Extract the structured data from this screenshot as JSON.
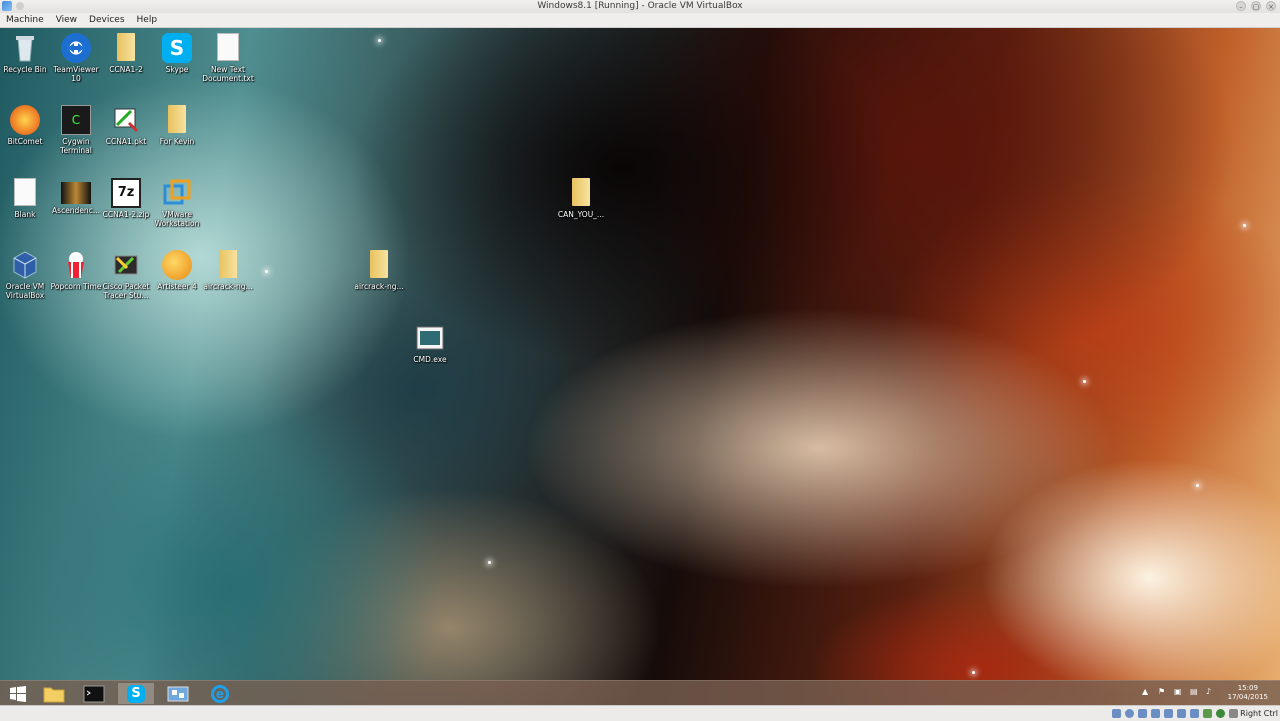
{
  "window": {
    "title": "Windows8.1 [Running] - Oracle VM VirtualBox",
    "controls": [
      "minimize",
      "maximize",
      "close"
    ]
  },
  "menubar": {
    "items": [
      "Machine",
      "View",
      "Devices",
      "Help"
    ]
  },
  "desktop": {
    "icons": [
      {
        "label": "Recycle Bin",
        "icon": "recycle-bin-icon"
      },
      {
        "label": "TeamViewer 10",
        "icon": "teamviewer-icon"
      },
      {
        "label": "CCNA1-2",
        "icon": "folder-icon"
      },
      {
        "label": "Skype",
        "icon": "skype-icon"
      },
      {
        "label": "New Text Document.txt",
        "icon": "text-file-icon"
      },
      {
        "label": "BitComet",
        "icon": "bitcomet-icon"
      },
      {
        "label": "Cygwin Terminal",
        "icon": "cygwin-icon"
      },
      {
        "label": "CCNA1.pkt",
        "icon": "packet-tracer-file-icon"
      },
      {
        "label": "For Kevin",
        "icon": "folder-icon"
      },
      {
        "label": "Blank",
        "icon": "blank-file-icon"
      },
      {
        "label": "Ascendenc...",
        "icon": "image-file-icon"
      },
      {
        "label": "CCNA1-2.zip",
        "icon": "7zip-icon"
      },
      {
        "label": "VMware Workstation",
        "icon": "vmware-icon"
      },
      {
        "label": "Oracle VM VirtualBox",
        "icon": "virtualbox-icon"
      },
      {
        "label": "Popcorn Time",
        "icon": "popcorn-time-icon"
      },
      {
        "label": "Cisco Packet Tracer Stu...",
        "icon": "cisco-packet-tracer-icon"
      },
      {
        "label": "Artisteer 4",
        "icon": "artisteer-icon"
      },
      {
        "label": "aircrack-ng...",
        "icon": "folder-icon"
      },
      {
        "label": "aircrack-ng...",
        "icon": "folder-icon"
      },
      {
        "label": "CAN_YOU_...",
        "icon": "folder-icon"
      },
      {
        "label": "CMD.exe",
        "icon": "cmd-exe-icon"
      }
    ]
  },
  "taskbar": {
    "items": [
      {
        "name": "start-button",
        "icon": "windows-logo-icon"
      },
      {
        "name": "file-explorer",
        "icon": "folder-icon"
      },
      {
        "name": "command-prompt",
        "icon": "terminal-icon"
      },
      {
        "name": "skype",
        "icon": "skype-icon",
        "active": true
      },
      {
        "name": "network-app",
        "icon": "network-icon"
      },
      {
        "name": "internet-explorer",
        "icon": "ie-icon"
      }
    ],
    "clock": {
      "time": "15:09",
      "date": "17/04/2015"
    }
  },
  "statusbar": {
    "host_key": "Right Ctrl"
  }
}
